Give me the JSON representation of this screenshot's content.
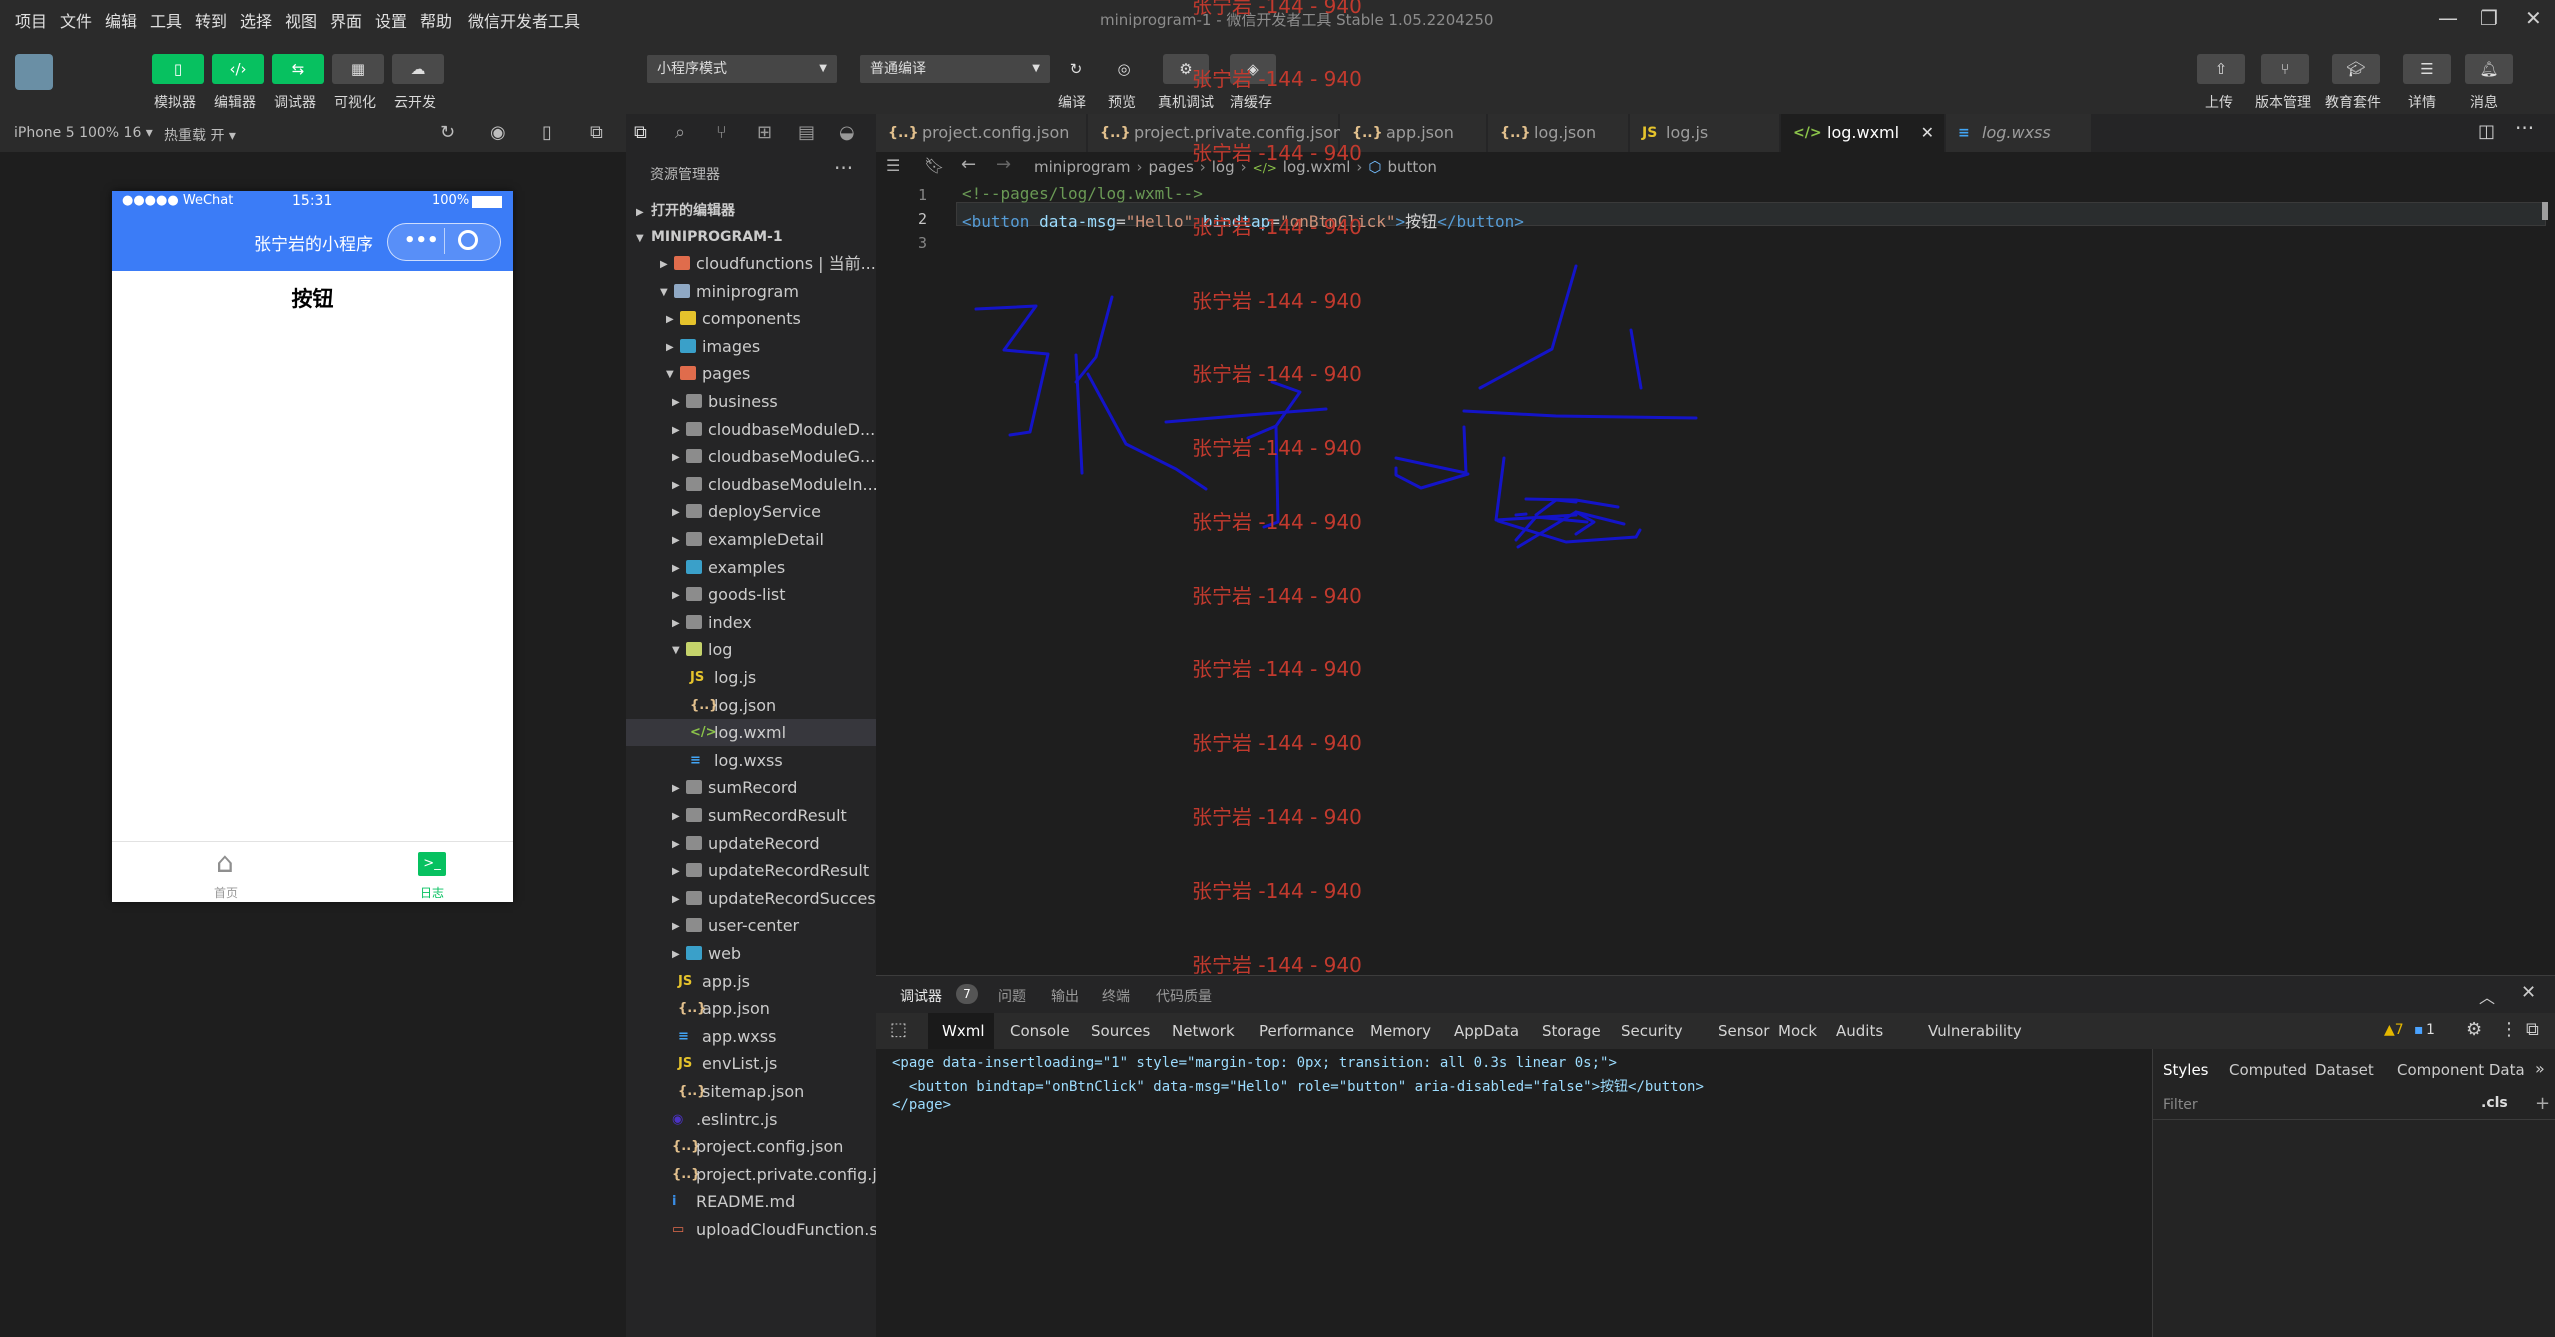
{
  "menubar": {
    "items": [
      "项目",
      "文件",
      "编辑",
      "工具",
      "转到",
      "选择",
      "视图",
      "界面",
      "设置",
      "帮助",
      "微信开发者工具"
    ],
    "title": "miniprogram-1 - 微信开发者工具 Stable 1.05.2204250"
  },
  "toolbar": {
    "left_buttons": [
      {
        "label": "模拟器",
        "icon": "phone-icon"
      },
      {
        "label": "编辑器",
        "icon": "code-icon"
      },
      {
        "label": "调试器",
        "icon": "debug-icon"
      },
      {
        "label": "可视化",
        "icon": "layout-icon"
      },
      {
        "label": "云开发",
        "icon": "cloud-icon"
      }
    ],
    "mode_select": "小程序模式",
    "compile_select": "普通编译",
    "mid_buttons": [
      {
        "label": "编译",
        "icon": "refresh-icon"
      },
      {
        "label": "预览",
        "icon": "eye-icon"
      },
      {
        "label": "真机调试",
        "icon": "bug-icon"
      },
      {
        "label": "清缓存",
        "icon": "layers-icon"
      }
    ],
    "right_buttons": [
      {
        "label": "上传",
        "icon": "upload-icon"
      },
      {
        "label": "版本管理",
        "icon": "branch-icon"
      },
      {
        "label": "教育套件",
        "icon": "graduation-icon"
      },
      {
        "label": "详情",
        "icon": "list-icon"
      },
      {
        "label": "消息",
        "icon": "bell-icon"
      }
    ]
  },
  "simulator": {
    "device": "iPhone 5 100% 16 ▾",
    "hotreload": "热重载 开 ▾",
    "status": {
      "carrier": "●●●●● WeChat",
      "time": "15:31",
      "battery": "100%"
    },
    "nav_title": "张宁岩的小程序",
    "page_text": "按钮",
    "tabbar": [
      {
        "label": "首页",
        "color": "#999999"
      },
      {
        "label": "日志",
        "color": "#07c160"
      }
    ]
  },
  "explorer": {
    "header": "资源管理器",
    "open_editors": "打开的编辑器",
    "root": "MINIPROGRAM-1",
    "tree": [
      {
        "name": "cloudfunctions | 当前...",
        "depth": 1,
        "type": "folder",
        "expanded": false
      },
      {
        "name": "miniprogram",
        "depth": 1,
        "type": "folder",
        "expanded": true
      },
      {
        "name": "components",
        "depth": 2,
        "type": "folder",
        "expanded": false
      },
      {
        "name": "images",
        "depth": 2,
        "type": "folder",
        "expanded": false
      },
      {
        "name": "pages",
        "depth": 2,
        "type": "folder",
        "expanded": true
      },
      {
        "name": "business",
        "depth": 3,
        "type": "folder",
        "expanded": false
      },
      {
        "name": "cloudbaseModuleD...",
        "depth": 3,
        "type": "folder",
        "expanded": false
      },
      {
        "name": "cloudbaseModuleG...",
        "depth": 3,
        "type": "folder",
        "expanded": false
      },
      {
        "name": "cloudbaseModuleIn...",
        "depth": 3,
        "type": "folder",
        "expanded": false
      },
      {
        "name": "deployService",
        "depth": 3,
        "type": "folder",
        "expanded": false
      },
      {
        "name": "exampleDetail",
        "depth": 3,
        "type": "folder",
        "expanded": false
      },
      {
        "name": "examples",
        "depth": 3,
        "type": "folder",
        "expanded": false
      },
      {
        "name": "goods-list",
        "depth": 3,
        "type": "folder",
        "expanded": false
      },
      {
        "name": "index",
        "depth": 3,
        "type": "folder",
        "expanded": false
      },
      {
        "name": "log",
        "depth": 3,
        "type": "folder",
        "expanded": true
      },
      {
        "name": "log.js",
        "depth": 4,
        "type": "js"
      },
      {
        "name": "log.json",
        "depth": 4,
        "type": "json"
      },
      {
        "name": "log.wxml",
        "depth": 4,
        "type": "wxml",
        "selected": true
      },
      {
        "name": "log.wxss",
        "depth": 4,
        "type": "wxss"
      },
      {
        "name": "sumRecord",
        "depth": 3,
        "type": "folder",
        "expanded": false
      },
      {
        "name": "sumRecordResult",
        "depth": 3,
        "type": "folder",
        "expanded": false
      },
      {
        "name": "updateRecord",
        "depth": 3,
        "type": "folder",
        "expanded": false
      },
      {
        "name": "updateRecordResult",
        "depth": 3,
        "type": "folder",
        "expanded": false
      },
      {
        "name": "updateRecordSuccess",
        "depth": 3,
        "type": "folder",
        "expanded": false
      },
      {
        "name": "user-center",
        "depth": 3,
        "type": "folder",
        "expanded": false
      },
      {
        "name": "web",
        "depth": 3,
        "type": "folder",
        "expanded": false
      },
      {
        "name": "app.js",
        "depth": 2,
        "type": "js"
      },
      {
        "name": "app.json",
        "depth": 2,
        "type": "json"
      },
      {
        "name": "app.wxss",
        "depth": 2,
        "type": "wxss"
      },
      {
        "name": "envList.js",
        "depth": 2,
        "type": "js"
      },
      {
        "name": "sitemap.json",
        "depth": 2,
        "type": "json"
      },
      {
        "name": ".eslintrc.js",
        "depth": 1,
        "type": "eslint"
      },
      {
        "name": "project.config.json",
        "depth": 1,
        "type": "json"
      },
      {
        "name": "project.private.config.js...",
        "depth": 1,
        "type": "json"
      },
      {
        "name": "README.md",
        "depth": 1,
        "type": "info"
      },
      {
        "name": "uploadCloudFunction.sh",
        "depth": 1,
        "type": "sh"
      }
    ]
  },
  "editor": {
    "tabs": [
      {
        "label": "project.config.json",
        "icon": "{..}",
        "color": "#e2c08d"
      },
      {
        "label": "project.private.config.json",
        "icon": "{..}",
        "color": "#e2c08d"
      },
      {
        "label": "app.json",
        "icon": "{..}",
        "color": "#e2c08d"
      },
      {
        "label": "log.json",
        "icon": "{..}",
        "color": "#e2c08d"
      },
      {
        "label": "log.js",
        "icon": "JS",
        "color": "#e5c32c"
      },
      {
        "label": "log.wxml",
        "icon": "</>",
        "color": "#8bc34a",
        "active": true
      },
      {
        "label": "log.wxss",
        "icon": "≡",
        "color": "#42a5f5",
        "italic": true
      }
    ],
    "breadcrumb": [
      "miniprogram",
      "pages",
      "log",
      "log.wxml",
      "button"
    ],
    "lines": [
      {
        "num": "1",
        "text": "<!--pages/log/log.wxml-->"
      },
      {
        "num": "2",
        "text": "<button data-msg=\"Hello\" bindtap=\"onBtnClick\">按钮</button>"
      },
      {
        "num": "3",
        "text": ""
      }
    ]
  },
  "watermark": "张宁岩 -144 - 940",
  "devtools": {
    "header_tabs": [
      {
        "label": "调试器",
        "badge": "7"
      },
      {
        "label": "问题"
      },
      {
        "label": "输出"
      },
      {
        "label": "终端"
      },
      {
        "label": "代码质量"
      }
    ],
    "panel_tabs": [
      "Wxml",
      "Console",
      "Sources",
      "Network",
      "Performance",
      "Memory",
      "AppData",
      "Storage",
      "Security",
      "Sensor",
      "Mock",
      "Audits",
      "Vulnerability"
    ],
    "active_panel": "Wxml",
    "warnings": "▲7",
    "errors": "1",
    "wxml": [
      "<page data-insertloading=\"1\" style=\"margin-top: 0px; transition: all 0.3s linear 0s;\">",
      "  <button bindtap=\"onBtnClick\" data-msg=\"Hello\" role=\"button\" aria-disabled=\"false\">按钮</button>",
      "</page>"
    ],
    "side_tabs": [
      "Styles",
      "Computed",
      "Dataset",
      "Component Data"
    ],
    "filter_placeholder": "Filter",
    "cls": ".cls"
  },
  "colors": {
    "accent_green": "#07c160",
    "nav_blue": "#3b7cf7",
    "watermark_red": "#c23a2e",
    "ink_blue": "#1414c8"
  }
}
